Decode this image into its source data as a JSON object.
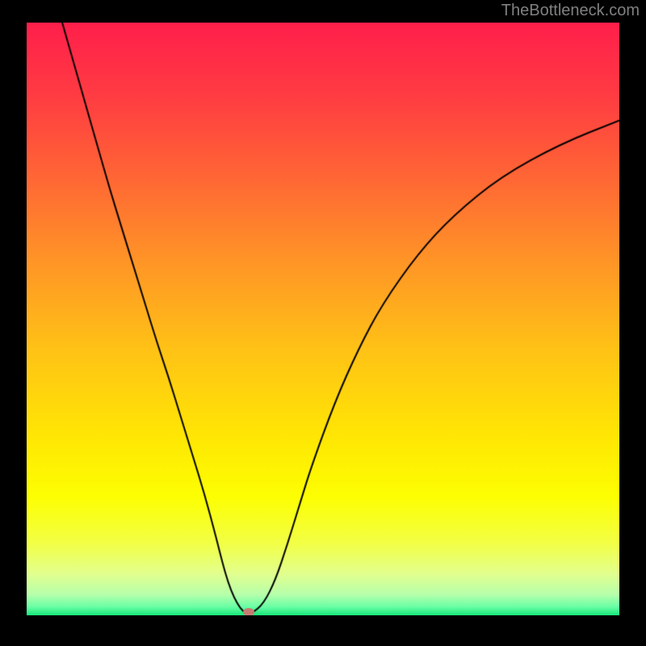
{
  "watermark": "TheBottleneck.com",
  "chart_data": {
    "type": "line",
    "title": "",
    "xlabel": "",
    "ylabel": "",
    "xlim": [
      0,
      100
    ],
    "ylim": [
      0,
      100
    ],
    "background": {
      "type": "vertical-gradient",
      "stops": [
        {
          "pos": 0.0,
          "color": "#ff1f4b"
        },
        {
          "pos": 0.12,
          "color": "#ff3b43"
        },
        {
          "pos": 0.25,
          "color": "#ff6336"
        },
        {
          "pos": 0.4,
          "color": "#ff9427"
        },
        {
          "pos": 0.55,
          "color": "#ffc216"
        },
        {
          "pos": 0.7,
          "color": "#ffe704"
        },
        {
          "pos": 0.8,
          "color": "#fdff02"
        },
        {
          "pos": 0.88,
          "color": "#f2ff47"
        },
        {
          "pos": 0.93,
          "color": "#e2ff8f"
        },
        {
          "pos": 0.965,
          "color": "#b7ffab"
        },
        {
          "pos": 0.985,
          "color": "#6cffa6"
        },
        {
          "pos": 1.0,
          "color": "#17e87b"
        }
      ]
    },
    "series": [
      {
        "name": "bottleneck-curve",
        "color": "#000000",
        "width": 2,
        "x": [
          6,
          8,
          10,
          12,
          14,
          16,
          18,
          20,
          22,
          24,
          26,
          28,
          30,
          32,
          33,
          34,
          35,
          36,
          37,
          38,
          40,
          42,
          44,
          46,
          48,
          52,
          56,
          60,
          66,
          72,
          80,
          90,
          100
        ],
        "y": [
          100,
          93,
          86,
          79,
          72,
          65.5,
          59,
          52.5,
          46,
          40,
          33.5,
          27,
          20.5,
          13,
          9,
          5.5,
          3,
          1.2,
          0.3,
          0.3,
          2,
          6,
          12,
          18.5,
          25,
          36,
          45,
          52.5,
          61,
          67.5,
          74,
          79.5,
          83.5
        ]
      }
    ],
    "marker": {
      "name": "bottleneck-point",
      "x": 37.5,
      "y": 0.6,
      "color": "#c77b70"
    }
  }
}
